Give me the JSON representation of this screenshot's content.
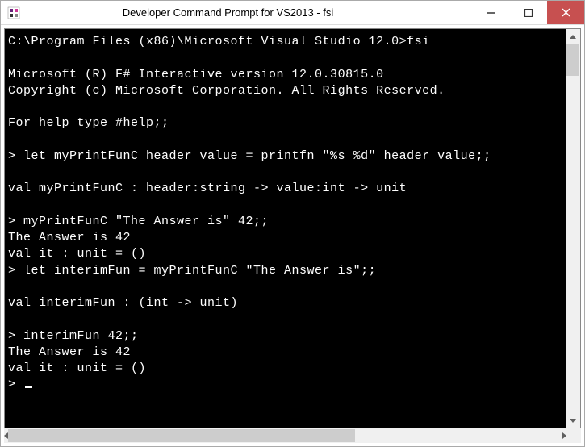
{
  "window": {
    "title": "Developer Command Prompt for VS2013 - fsi"
  },
  "terminal": {
    "lines": [
      "C:\\Program Files (x86)\\Microsoft Visual Studio 12.0>fsi",
      "",
      "Microsoft (R) F# Interactive version 12.0.30815.0",
      "Copyright (c) Microsoft Corporation. All Rights Reserved.",
      "",
      "For help type #help;;",
      "",
      "> let myPrintFunC header value = printfn \"%s %d\" header value;;",
      "",
      "val myPrintFunC : header:string -> value:int -> unit",
      "",
      "> myPrintFunC \"The Answer is\" 42;;",
      "The Answer is 42",
      "val it : unit = ()",
      "> let interimFun = myPrintFunC \"The Answer is\";;",
      "",
      "val interimFun : (int -> unit)",
      "",
      "> interimFun 42;;",
      "The Answer is 42",
      "val it : unit = ()",
      "> "
    ]
  }
}
